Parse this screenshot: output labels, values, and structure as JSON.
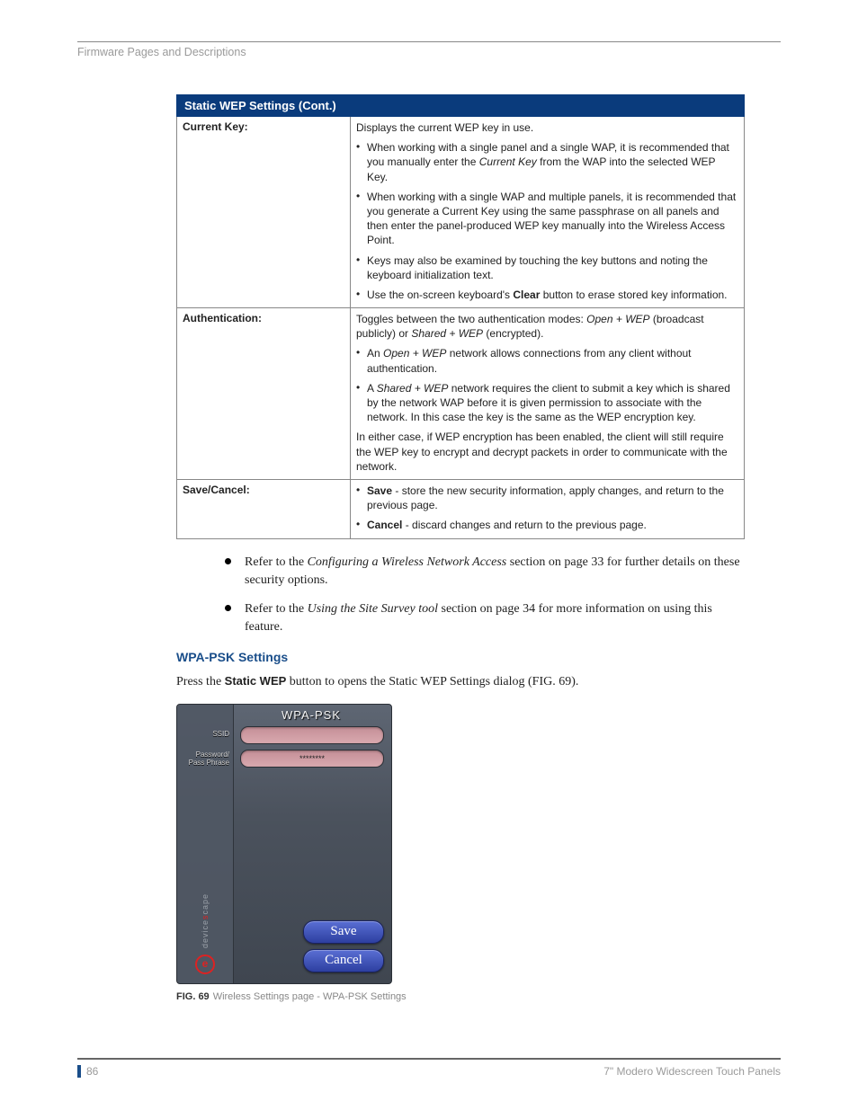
{
  "header": {
    "section_title": "Firmware Pages and Descriptions"
  },
  "table": {
    "title": "Static WEP Settings (Cont.)",
    "rows": [
      {
        "label": "Current Key:",
        "content": {
          "intro": "Displays the current WEP key in use.",
          "b1": {
            "pre": "When working with a single panel and a single WAP, it is recommended that you manually enter the ",
            "i1": "Current Key",
            "post": " from the WAP into the selected WEP Key."
          },
          "b2": "When working with a single WAP and multiple panels, it is recommended that you generate a Current Key using the same passphrase on all panels and then enter the panel-produced WEP key manually into the Wireless Access Point.",
          "b3": "Keys may also be examined by touching the key buttons and noting the keyboard initialization text.",
          "b4": {
            "pre": "Use the on-screen keyboard's ",
            "bold": "Clear",
            "post": " button to erase stored key information."
          }
        }
      },
      {
        "label": "Authentication:",
        "content": {
          "intro": {
            "pre": "Toggles between the two authentication modes: ",
            "i1": "Open + WEP",
            "mid": " (broadcast publicly) or ",
            "i2": "Shared + WEP",
            "post": " (encrypted)."
          },
          "b1": {
            "pre": "An ",
            "i1": "Open + WEP",
            "post": " network allows connections from any client without authentication."
          },
          "b2": {
            "pre": "A ",
            "i1": "Shared + WEP",
            "post": " network requires the client to submit a key which is shared by the network WAP before it is given permission to associate with the network. In this case the key is the same as the WEP encryption key."
          },
          "outro": "In either case, if WEP encryption has been enabled, the client will still require the WEP key to encrypt and decrypt packets in order to communicate with the network."
        }
      },
      {
        "label": "Save/Cancel:",
        "content": {
          "b1": {
            "bold": "Save",
            "post": " - store the new security information, apply changes, and return to the previous page."
          },
          "b2": {
            "bold": "Cancel",
            "post": " - discard changes and return to the previous page."
          }
        }
      }
    ]
  },
  "notes": {
    "n1": {
      "pre": "Refer to the ",
      "i": "Configuring a Wireless Network Access",
      "post": " section on page 33 for further details on these security options."
    },
    "n2": {
      "pre": "Refer to the ",
      "i": "Using the Site Survey tool",
      "post": " section on page 34 for more information on using this feature."
    }
  },
  "section": {
    "heading": "WPA-PSK Settings",
    "body": {
      "pre": "Press the ",
      "bold": "Static WEP",
      "post": " button to opens the Static WEP Settings dialog (FIG. 69)."
    }
  },
  "dialog": {
    "title": "WPA-PSK",
    "ssid_label": "SSID",
    "pass_label_1": "Password/",
    "pass_label_2": "Pass Phrase",
    "ssid_value": "",
    "pass_value": "********",
    "save": "Save",
    "cancel": "Cancel",
    "brand_pre": "device",
    "brand_mid": "s",
    "brand_post": "cape",
    "logo_letter": "e"
  },
  "figure": {
    "num": "FIG. 69",
    "caption": "Wireless Settings page - WPA-PSK Settings"
  },
  "footer": {
    "page": "86",
    "product": "7\" Modero Widescreen Touch Panels"
  }
}
